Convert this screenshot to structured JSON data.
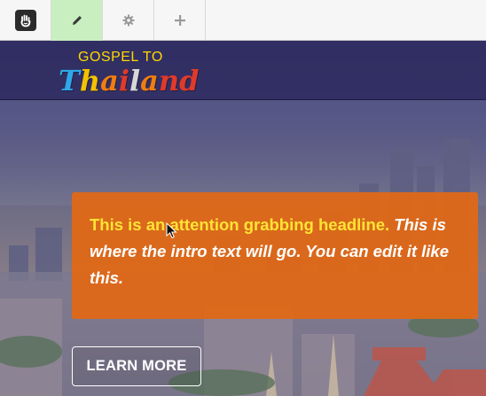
{
  "toolbar": {
    "logo_icon": "concrete5-hand-icon",
    "edit_icon": "pencil-icon",
    "settings_icon": "gear-icon",
    "add_icon": "plus-icon",
    "active_color": "#c9efc0"
  },
  "brand": {
    "line1": "GOSPEL TO",
    "line2_letters": [
      "T",
      "h",
      "a",
      "i",
      "l",
      "a",
      "n",
      "d"
    ],
    "letter_colors": [
      "#2ea8e8",
      "#f2c200",
      "#ef7d10",
      "#e03a2a",
      "#d8d8d8",
      "#ef7d10",
      "#e03a2a",
      "#e03a2a"
    ]
  },
  "hero": {
    "headline_strong": "This is an attention grabbing headline.",
    "headline_rest": " This is where the intro text will go.  You can edit it like this.",
    "box_color": "#e26814",
    "button_label": "LEARN MORE"
  }
}
